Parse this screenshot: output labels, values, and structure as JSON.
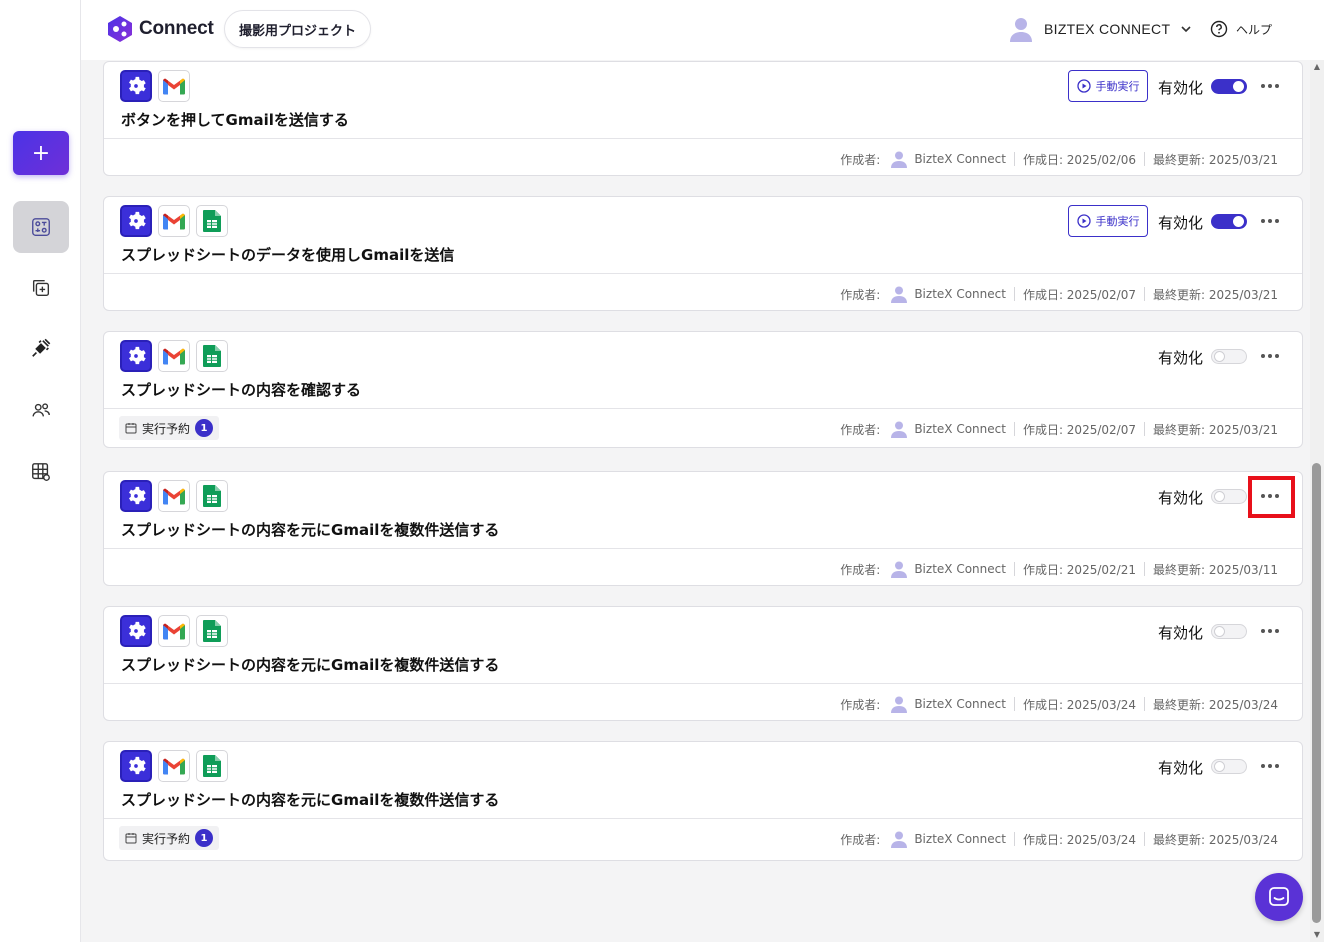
{
  "header": {
    "brand": "Connect",
    "project": "撮影用プロジェクト",
    "user_name": "BIZTEX CONNECT",
    "help_label": "ヘルプ"
  },
  "sidebar": {
    "add_label": "+"
  },
  "labels": {
    "run": "手動実行",
    "enable": "有効化",
    "creator": "作成者:",
    "schedule": "実行予約"
  },
  "cards": [
    {
      "apps": [
        "gear-icon",
        "gmail-icon"
      ],
      "title": "ボタンを押してGmailを送信する",
      "manual_run": true,
      "enabled": true,
      "creator_name": "BizteX Connect",
      "created": "作成日: 2025/02/06",
      "updated": "最終更新: 2025/03/21"
    },
    {
      "apps": [
        "gear-icon",
        "gmail-icon",
        "sheets-icon"
      ],
      "title": "スプレッドシートのデータを使用しGmailを送信",
      "manual_run": true,
      "enabled": true,
      "creator_name": "BizteX Connect",
      "created": "作成日: 2025/02/07",
      "updated": "最終更新: 2025/03/21"
    },
    {
      "apps": [
        "gear-icon",
        "gmail-icon",
        "sheets-icon"
      ],
      "title": "スプレッドシートの内容を確認する",
      "manual_run": false,
      "enabled": false,
      "schedule_count": "1",
      "creator_name": "BizteX Connect",
      "created": "作成日: 2025/02/07",
      "updated": "最終更新: 2025/03/21"
    },
    {
      "apps": [
        "gear-icon",
        "gmail-icon",
        "sheets-icon"
      ],
      "title": "スプレッドシートの内容を元にGmailを複数件送信する",
      "manual_run": false,
      "enabled": false,
      "creator_name": "BizteX Connect",
      "created": "作成日: 2025/02/21",
      "updated": "最終更新: 2025/03/11"
    },
    {
      "apps": [
        "gear-icon",
        "gmail-icon",
        "sheets-icon"
      ],
      "title": "スプレッドシートの内容を元にGmailを複数件送信する",
      "manual_run": false,
      "enabled": false,
      "creator_name": "BizteX Connect",
      "created": "作成日: 2025/03/24",
      "updated": "最終更新: 2025/03/24"
    },
    {
      "apps": [
        "gear-icon",
        "gmail-icon",
        "sheets-icon"
      ],
      "title": "スプレッドシートの内容を元にGmailを複数件送信する",
      "manual_run": false,
      "enabled": false,
      "schedule_count": "1",
      "creator_name": "BizteX Connect",
      "created": "作成日: 2025/03/24",
      "updated": "最終更新: 2025/03/24"
    }
  ],
  "colors": {
    "accent": "#3b30c9",
    "highlight": "#e8101a",
    "chat": "#5a32d6"
  }
}
